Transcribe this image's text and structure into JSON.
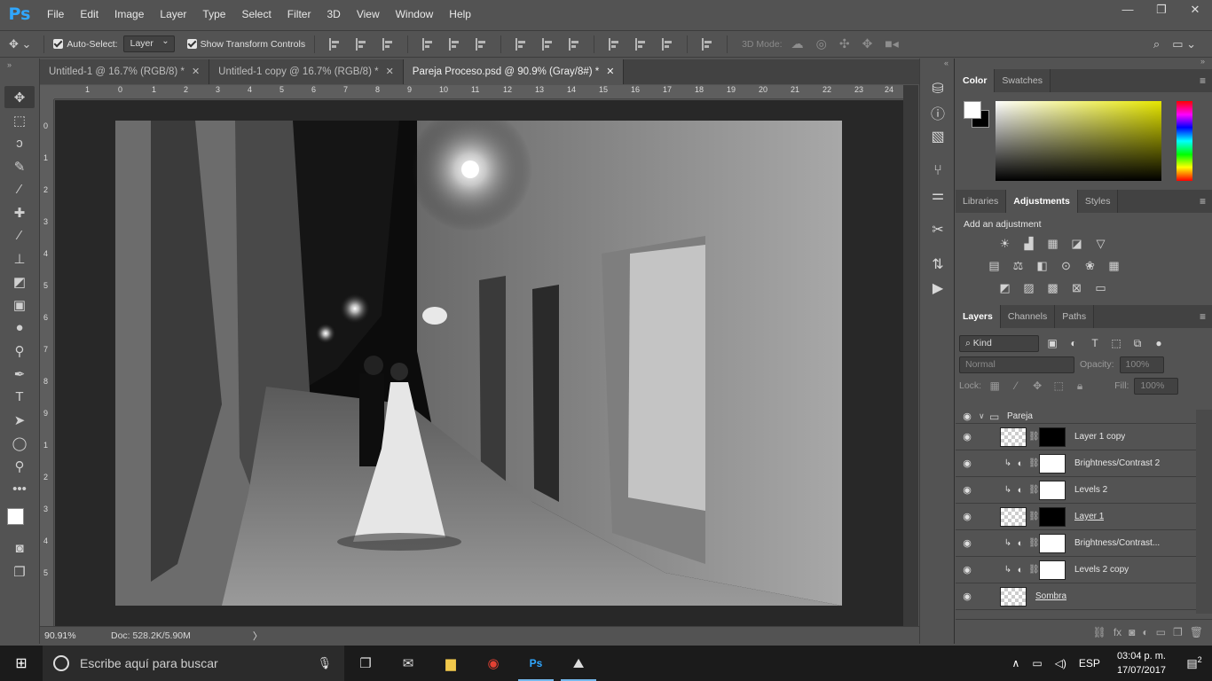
{
  "app": {
    "logo": "Ps"
  },
  "menu": [
    "File",
    "Edit",
    "Image",
    "Layer",
    "Type",
    "Select",
    "Filter",
    "3D",
    "View",
    "Window",
    "Help"
  ],
  "window_controls": {
    "minimize": "—",
    "restore": "❐",
    "close": "✕"
  },
  "options": {
    "auto_select_label": "Auto-Select:",
    "auto_select_value": "Layer",
    "show_transform_label": "Show Transform Controls",
    "mode_3d_label": "3D Mode:"
  },
  "tabs": [
    {
      "label": "Untitled-1 @ 16.7% (RGB/8) *",
      "active": false
    },
    {
      "label": "Untitled-1 copy @ 16.7% (RGB/8) *",
      "active": false
    },
    {
      "label": "Pareja Proceso.psd @ 90.9% (Gray/8#) *",
      "active": true
    }
  ],
  "ruler_top": [
    "1",
    "0",
    "1",
    "2",
    "3",
    "4",
    "5",
    "6",
    "7",
    "8",
    "9",
    "10",
    "11",
    "12",
    "13",
    "14",
    "15",
    "16",
    "17",
    "18",
    "19",
    "20",
    "21",
    "22",
    "23",
    "24"
  ],
  "ruler_left": [
    "0",
    "1",
    "2",
    "3",
    "4",
    "5",
    "6",
    "7",
    "8",
    "9",
    "1",
    "2",
    "3",
    "4",
    "5"
  ],
  "status": {
    "zoom": "90.91%",
    "doc": "Doc: 528.2K/5.90M",
    "arrow": "〉"
  },
  "color_panel": {
    "tabs": [
      "Color",
      "Swatches"
    ],
    "active": "Color",
    "fg_color": "#ffffff",
    "bg_color": "#000000"
  },
  "adjustments_panel": {
    "tabs": [
      "Libraries",
      "Adjustments",
      "Styles"
    ],
    "active": "Adjustments",
    "title": "Add an adjustment"
  },
  "layers_panel": {
    "tabs": [
      "Layers",
      "Channels",
      "Paths"
    ],
    "active": "Layers",
    "kind_label": "⌕ Kind",
    "blend_mode": "Normal",
    "opacity_label": "Opacity:",
    "opacity_value": "100%",
    "lock_label": "Lock:",
    "fill_label": "Fill:",
    "fill_value": "100%",
    "layers": [
      {
        "name": "Pareja",
        "type": "group"
      },
      {
        "name": "Layer 1 copy",
        "type": "masked"
      },
      {
        "name": "Brightness/Contrast 2",
        "type": "adjustment"
      },
      {
        "name": "Levels 2",
        "type": "adjustment"
      },
      {
        "name": "Layer 1",
        "type": "masked"
      },
      {
        "name": "Brightness/Contrast...",
        "type": "adjustment"
      },
      {
        "name": "Levels 2 copy",
        "type": "adjustment"
      },
      {
        "name": "Sombra",
        "type": "pixel"
      }
    ]
  },
  "taskbar": {
    "search_placeholder": "Escribe aquí para buscar",
    "language": "ESP",
    "time": "03:04 p. m.",
    "date": "17/07/2017",
    "notifications": "2"
  }
}
